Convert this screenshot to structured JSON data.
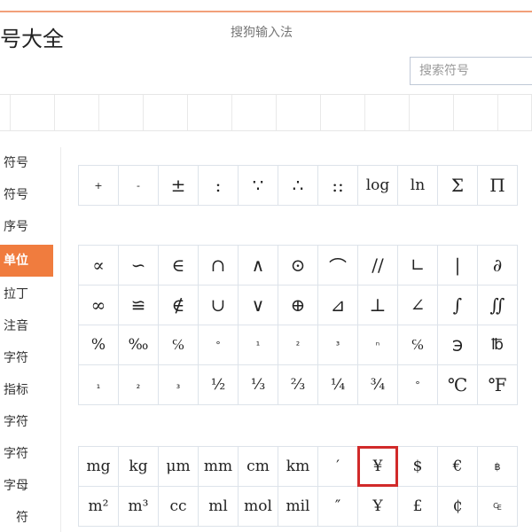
{
  "header": {
    "app_title": "号大全",
    "window_title": "搜狗输入法"
  },
  "search": {
    "placeholder": "搜索符号"
  },
  "sidebar": {
    "items": [
      {
        "label": "符号",
        "active": false
      },
      {
        "label": "符号",
        "active": false
      },
      {
        "label": "序号",
        "active": false
      },
      {
        "label": "单位",
        "active": true
      },
      {
        "label": "拉丁",
        "active": false
      },
      {
        "label": "注音",
        "active": false
      },
      {
        "label": "字符",
        "active": false
      },
      {
        "label": "指标",
        "active": false
      },
      {
        "label": "字符",
        "active": false
      },
      {
        "label": "字符",
        "active": false
      },
      {
        "label": "字母",
        "active": false
      },
      {
        "label": "符",
        "active": false
      }
    ]
  },
  "symbols": {
    "math_row": [
      "+",
      "-",
      "±",
      ":",
      "∵",
      "∴",
      "::",
      "log",
      "ln",
      "Σ",
      "Π"
    ],
    "grid_a": [
      [
        "∝",
        "∽",
        "∈",
        "∩",
        "∧",
        "⊙",
        "⌒",
        "//",
        "∟",
        "|",
        "∂"
      ],
      [
        "∞",
        "≌",
        "∉",
        "∪",
        "∨",
        "⊕",
        "⊿",
        "⊥",
        "∠",
        "∫",
        "∬"
      ],
      [
        "%",
        "‰",
        "℅",
        "°",
        "¹",
        "²",
        "³",
        "ⁿ",
        "℅",
        "℈",
        "℔"
      ],
      [
        "₁",
        "₂",
        "₃",
        "½",
        "⅓",
        "⅔",
        "¼",
        "¾",
        "°",
        "℃",
        "℉"
      ]
    ],
    "grid_b": [
      [
        "mg",
        "kg",
        "μm",
        "mm",
        "cm",
        "km",
        "′",
        "¥",
        "$",
        "€",
        "฿"
      ],
      [
        "m²",
        "m³",
        "cc",
        "ml",
        "mol",
        "mil",
        "″",
        "Ұ",
        "£",
        "₵",
        "₠"
      ]
    ],
    "selected": "¥"
  }
}
